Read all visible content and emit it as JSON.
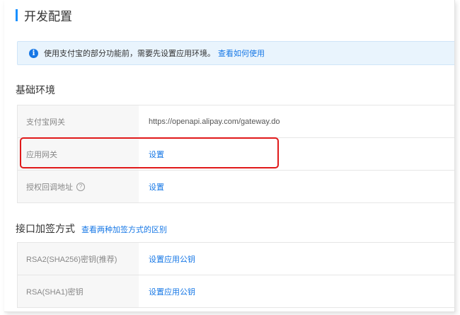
{
  "page": {
    "title": "开发配置"
  },
  "notice": {
    "text": "使用支付宝的部分功能前，需要先设置应用环境。",
    "link": "查看如何使用",
    "icon": "info-icon"
  },
  "basic_env": {
    "title": "基础环境",
    "rows": [
      {
        "label": "支付宝网关",
        "value": "https://openapi.alipay.com/gateway.do"
      },
      {
        "label": "应用网关",
        "value": "设置"
      },
      {
        "label": "授权回调地址",
        "value": "设置"
      }
    ]
  },
  "signing": {
    "title": "接口加签方式",
    "link": "查看两种加签方式的区别",
    "rows": [
      {
        "label": "RSA2(SHA256)密钥(推荐)",
        "value": "设置应用公钥"
      },
      {
        "label": "RSA(SHA1)密钥",
        "value": "设置应用公钥"
      }
    ]
  },
  "colors": {
    "accent": "#1677e6",
    "highlight_box": "#e0191a",
    "notice_bg": "#e9f4fd"
  }
}
